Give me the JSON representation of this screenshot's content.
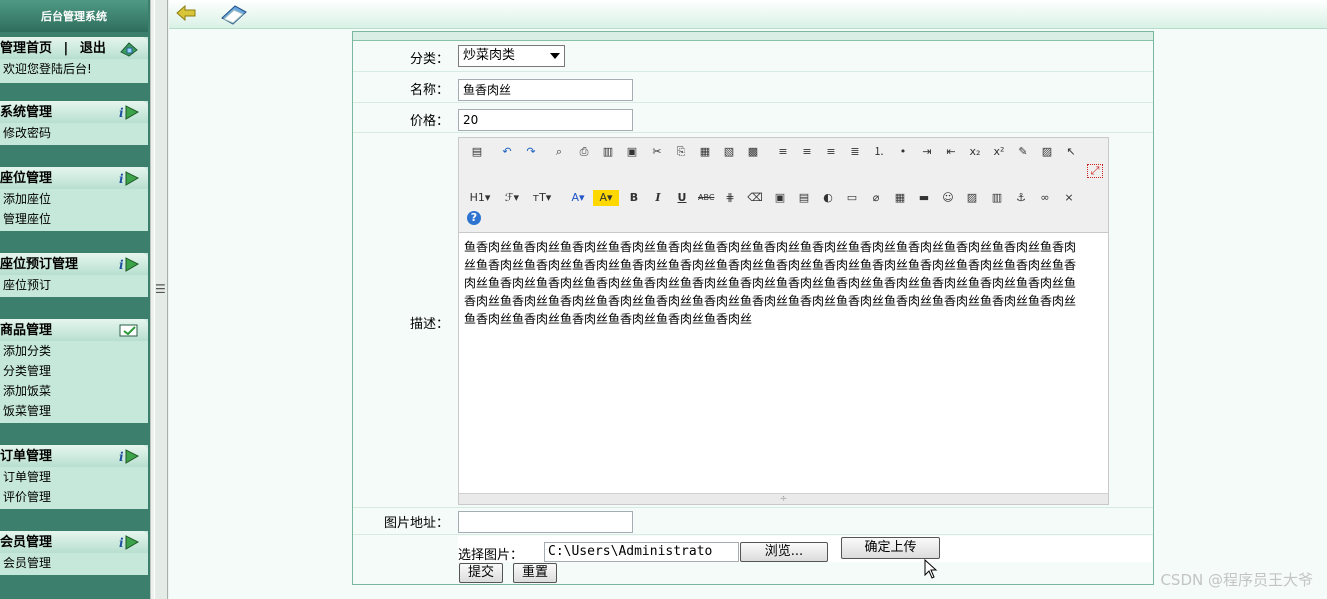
{
  "sidebar": {
    "brand": "后台管理系统",
    "home": {
      "home_link": "管理首页",
      "separator": "|",
      "logout_link": "退出",
      "welcome": "欢迎您登陆后台!"
    },
    "menus": [
      {
        "title": "系统管理",
        "items": [
          "修改密码"
        ]
      },
      {
        "title": "座位管理",
        "items": [
          "添加座位",
          "管理座位"
        ]
      },
      {
        "title": "座位预订管理",
        "items": [
          "座位预订"
        ]
      },
      {
        "title": "商品管理",
        "items": [
          "添加分类",
          "分类管理",
          "添加饭菜",
          "饭菜管理"
        ]
      },
      {
        "title": "订单管理",
        "items": [
          "订单管理",
          "评价管理"
        ]
      },
      {
        "title": "会员管理",
        "items": [
          "会员管理"
        ]
      }
    ]
  },
  "form": {
    "category_label": "分类：",
    "category_value": "炒菜肉类",
    "name_label": "名称：",
    "name_value": "鱼香肉丝",
    "price_label": "价格：",
    "price_value": "20",
    "desc_label": "描述：",
    "desc_value": "鱼香肉丝鱼香肉丝鱼香肉丝鱼香肉丝鱼香肉丝鱼香肉丝鱼香肉丝鱼香肉丝鱼香肉丝鱼香肉丝鱼香肉丝鱼香肉丝鱼香肉丝鱼香肉丝鱼香肉丝鱼香肉丝鱼香肉丝鱼香肉丝鱼香肉丝鱼香肉丝鱼香肉丝鱼香肉丝鱼香肉丝鱼香肉丝鱼香肉丝鱼香肉丝鱼香肉丝鱼香肉丝鱼香肉丝鱼香肉丝鱼香肉丝鱼香肉丝鱼香肉丝鱼香肉丝鱼香肉丝鱼香肉丝鱼香肉丝鱼香肉丝鱼香肉丝鱼香肉丝鱼香肉丝鱼香肉丝鱼香肉丝鱼香肉丝鱼香肉丝鱼香肉丝鱼香肉丝鱼香肉丝鱼香肉丝鱼香肉丝鱼香肉丝鱼香肉丝鱼香肉丝鱼香肉丝鱼香肉丝鱼香肉丝鱼香肉丝",
    "image_url_label": "图片地址：",
    "image_url_value": "",
    "choose_image_label": "选择图片：",
    "file_path": "C:\\Users\\Administrato",
    "browse_button": "浏览...",
    "upload_button": "确定上传",
    "submit_button": "提交",
    "reset_button": "重置"
  },
  "editor": {
    "toolbar_row1": [
      "source-icon",
      "undo-icon",
      "redo-icon",
      "preview-icon",
      "print-icon",
      "template-icon",
      "code-icon",
      "cut-icon",
      "copy-icon",
      "paste-icon",
      "paste-plain-icon",
      "paste-word-icon",
      "align-left-icon",
      "align-center-icon",
      "align-right-icon",
      "justify-icon",
      "ordered-list-icon",
      "unordered-list-icon",
      "indent-icon",
      "outdent-icon",
      "subscript-icon",
      "superscript-icon",
      "clear-format-icon",
      "select-all-icon",
      "cursor-icon",
      "fullscreen-icon"
    ],
    "toolbar_row2": [
      {
        "name": "heading-icon",
        "glyph": "H1▾"
      },
      {
        "name": "font-family-icon",
        "glyph": "ℱ▾"
      },
      {
        "name": "font-size-icon",
        "glyph": "ᴛT▾"
      },
      {
        "name": "font-color-icon",
        "glyph": "A▾"
      },
      {
        "name": "highlight-icon",
        "glyph": "A▾"
      },
      {
        "name": "bold-icon",
        "glyph": "B"
      },
      {
        "name": "italic-icon",
        "glyph": "I"
      },
      {
        "name": "underline-icon",
        "glyph": "U"
      },
      {
        "name": "strikethrough-icon",
        "glyph": "ABC"
      },
      {
        "name": "line-height-icon",
        "glyph": "⋕"
      },
      {
        "name": "eraser-icon",
        "glyph": "⌫"
      },
      {
        "name": "image-insert-icon",
        "glyph": "▣"
      },
      {
        "name": "multi-image-icon",
        "glyph": "▤"
      },
      {
        "name": "flash-icon",
        "glyph": "◐"
      },
      {
        "name": "media-icon",
        "glyph": "▭"
      },
      {
        "name": "attachment-icon",
        "glyph": "⌀"
      },
      {
        "name": "table-icon",
        "glyph": "▦"
      },
      {
        "name": "horizontal-line-icon",
        "glyph": "▬"
      },
      {
        "name": "emoticon-icon",
        "glyph": "☺"
      },
      {
        "name": "map-icon",
        "glyph": "▨"
      },
      {
        "name": "page-break-icon",
        "glyph": "▥"
      },
      {
        "name": "anchor-icon",
        "glyph": "⚓"
      },
      {
        "name": "link-icon",
        "glyph": "∞"
      },
      {
        "name": "unlink-icon",
        "glyph": "⨯"
      },
      {
        "name": "help-icon",
        "glyph": "?"
      }
    ],
    "resize_glyph": "÷"
  },
  "watermark": "CSDN @程序员王大爷",
  "colors": {
    "sidebar_bg": "#3b7f6c",
    "menu_bg": "#c6e8da",
    "main_bg": "#f4fbf8",
    "accent": "#79b89f"
  }
}
